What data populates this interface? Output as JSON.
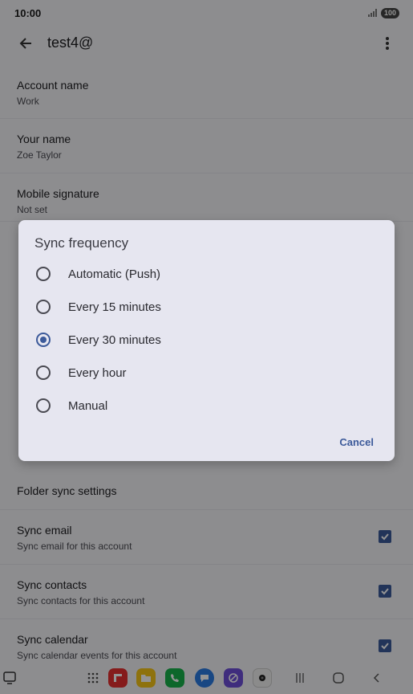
{
  "status": {
    "time": "10:00",
    "battery": "100"
  },
  "app_bar": {
    "title": "test4@"
  },
  "settings": [
    {
      "title": "Account name",
      "subtitle": "Work"
    },
    {
      "title": "Your name",
      "subtitle": "Zoe Taylor"
    },
    {
      "title": "Mobile signature",
      "subtitle": "Not set"
    },
    {
      "title": "Folder sync settings"
    },
    {
      "title": "Sync email",
      "subtitle": "Sync email for this account",
      "checked": true
    },
    {
      "title": "Sync contacts",
      "subtitle": "Sync contacts for this account",
      "checked": true
    },
    {
      "title": "Sync calendar",
      "subtitle": "Sync calendar events for this account",
      "checked": true
    }
  ],
  "dialog": {
    "title": "Sync frequency",
    "options": [
      {
        "label": "Automatic (Push)",
        "selected": false
      },
      {
        "label": "Every 15 minutes",
        "selected": false
      },
      {
        "label": "Every 30 minutes",
        "selected": true
      },
      {
        "label": "Every hour",
        "selected": false
      },
      {
        "label": "Manual",
        "selected": false
      }
    ],
    "cancel_label": "Cancel"
  },
  "colors": {
    "accent": "#3c5a9a",
    "background": "#f3f3f7",
    "dialog": "#e6e6f0"
  },
  "nav_bar": {
    "apps": [
      "apps-grid-icon",
      "flipboard-icon",
      "files-icon",
      "phone-icon",
      "messages-icon",
      "browser-icon",
      "camera-icon"
    ],
    "buttons": [
      "recents-icon",
      "home-icon",
      "back-icon"
    ]
  }
}
